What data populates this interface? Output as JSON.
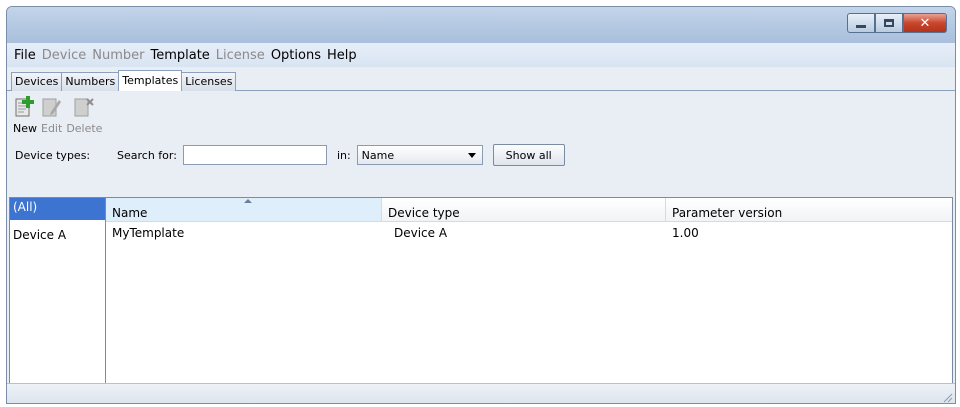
{
  "window": {
    "title": "",
    "controls": {
      "minimize_icon": "minimize-icon",
      "maximize_icon": "maximize-icon",
      "close_label": "✕"
    }
  },
  "menu": [
    {
      "label": "File",
      "enabled": true
    },
    {
      "label": "Device",
      "enabled": false
    },
    {
      "label": "Number",
      "enabled": false
    },
    {
      "label": "Template",
      "enabled": true
    },
    {
      "label": "License",
      "enabled": false
    },
    {
      "label": "Options",
      "enabled": true
    },
    {
      "label": "Help",
      "enabled": true
    }
  ],
  "tabs": [
    {
      "label": "Devices",
      "active": false
    },
    {
      "label": "Numbers",
      "active": false
    },
    {
      "label": "Templates",
      "active": true
    },
    {
      "label": "Licenses",
      "active": false
    }
  ],
  "toolbar": {
    "new_label": "New",
    "edit_label": "Edit",
    "delete_label": "Delete"
  },
  "search": {
    "device_types_label": "Device types:",
    "search_for_label": "Search for:",
    "search_value": "",
    "in_label": "in:",
    "in_selected": "Name",
    "show_all_label": "Show all"
  },
  "device_types": [
    {
      "label": "(All)",
      "selected": true
    },
    {
      "label": "Device A",
      "selected": false
    }
  ],
  "table": {
    "columns": [
      "Name",
      "Device type",
      "Parameter version"
    ],
    "rows": [
      [
        "MyTemplate",
        "Device A",
        "1.00"
      ]
    ]
  },
  "colors": {
    "selection": "#3d73d1",
    "titlebar": "#b5c9e3",
    "close_button": "#c9462c"
  }
}
